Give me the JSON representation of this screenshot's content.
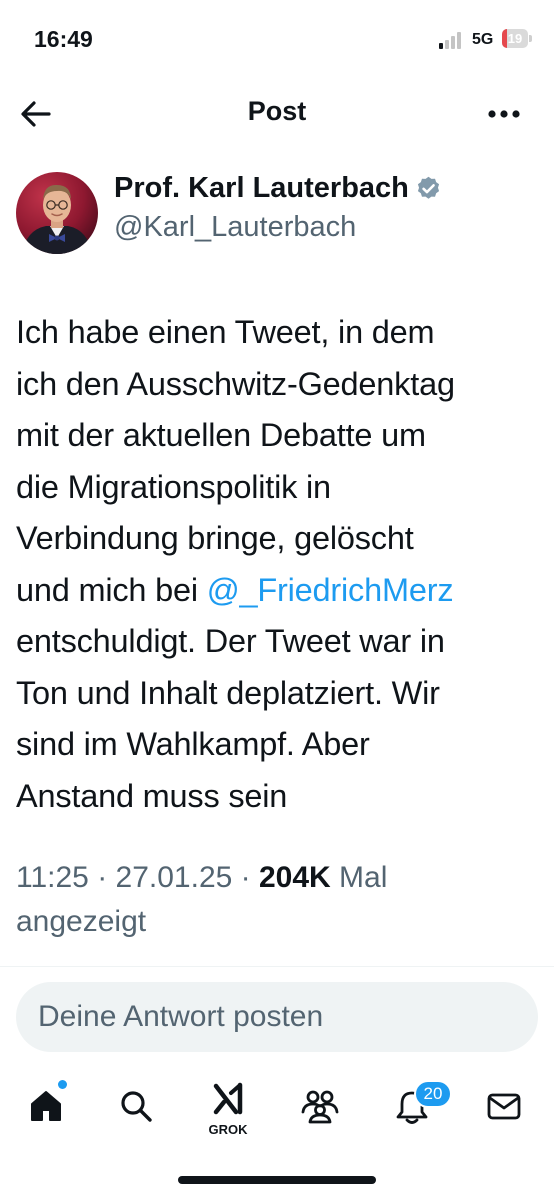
{
  "status_bar": {
    "time": "16:49",
    "network": "5G",
    "battery": {
      "level": 19,
      "label": "19",
      "color": "#e5484d"
    },
    "signal_bars_active": 1
  },
  "header": {
    "title": "Post",
    "back_icon": "arrow-left-icon",
    "more_icon": "more-horizontal-icon"
  },
  "post": {
    "author_name": "Prof. Karl Lauterbach",
    "verified": true,
    "handle": "@Karl_Lauterbach",
    "text_lines": [
      "Ich habe einen Tweet, in dem",
      "ich den Ausschwitz-Gedenktag",
      "mit der aktuellen Debatte um",
      "die Migrationspolitik in",
      "Verbindung bringe, gelöscht",
      {
        "before": "und mich bei ",
        "mention": "@_FriedrichMerz"
      },
      "entschuldigt. Der Tweet war in",
      "Ton und Inhalt deplatziert. Wir",
      "sind im Wahlkampf. Aber",
      "Anstand muss sein"
    ],
    "time": "11:25",
    "date": "27.01.25",
    "separator": " · ",
    "views": "204K",
    "views_label_1": " Mal",
    "views_label_2": "angezeigt"
  },
  "reply": {
    "placeholder": "Deine Antwort posten"
  },
  "tabbar": {
    "items": [
      {
        "name": "home",
        "icon": "home-icon",
        "has_dot": true
      },
      {
        "name": "search",
        "icon": "search-icon"
      },
      {
        "name": "grok",
        "icon": "grok-icon",
        "label": "GROK"
      },
      {
        "name": "communities",
        "icon": "communities-icon"
      },
      {
        "name": "notifications",
        "icon": "bell-icon",
        "badge": "20"
      },
      {
        "name": "messages",
        "icon": "mail-icon"
      }
    ]
  },
  "colors": {
    "accent": "#1d9bf0",
    "text": "#0f1419",
    "secondary_text": "#536471",
    "verified": "#829aab"
  }
}
